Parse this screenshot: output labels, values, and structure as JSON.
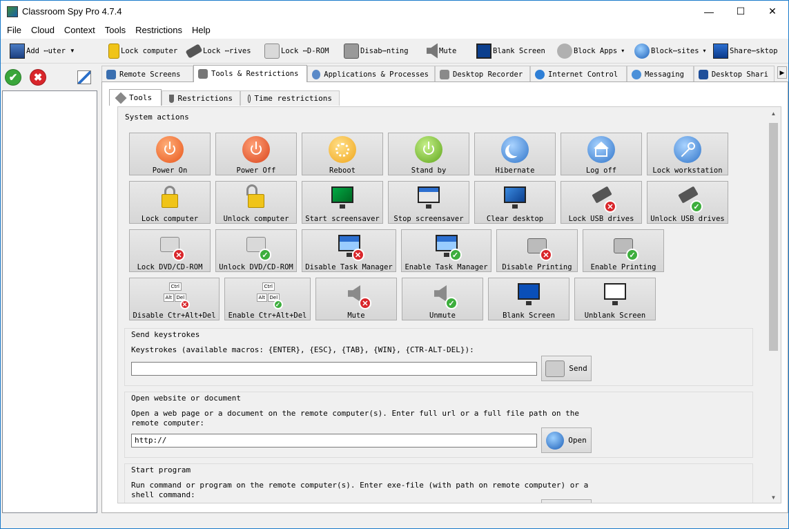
{
  "window": {
    "title": "Classroom Spy Pro 4.7.4",
    "minimize": "—",
    "maximize": "☐",
    "close": "✕"
  },
  "menu": [
    "File",
    "Cloud",
    "Context",
    "Tools",
    "Restrictions",
    "Help"
  ],
  "toolbar": [
    {
      "label": "Add ⋯uter",
      "icon": "add-computer-icon",
      "caret": "▼"
    },
    {
      "label": "Lock computer",
      "icon": "lock-icon"
    },
    {
      "label": "Lock ⋯rives",
      "icon": "lock-drives-icon"
    },
    {
      "label": "Lock ⋯D-ROM",
      "icon": "lock-cdrom-icon"
    },
    {
      "label": "Disab⋯nting",
      "icon": "disable-printing-icon"
    },
    {
      "label": "Mute",
      "icon": "mute-icon"
    },
    {
      "label": "Blank Screen",
      "icon": "blank-screen-icon"
    },
    {
      "label": "Block Apps",
      "icon": "block-apps-icon",
      "caret": "▾"
    },
    {
      "label": "Block⋯sites",
      "icon": "block-websites-icon",
      "caret": "▾"
    },
    {
      "label": "Share⋯sktop",
      "icon": "share-desktop-icon"
    }
  ],
  "left_tools": {
    "ok": "✔",
    "cancel": "✖"
  },
  "main_tabs": [
    {
      "label": "Remote Screens",
      "color": "#3a6fb0"
    },
    {
      "label": "Tools & Restrictions",
      "color": "#777777",
      "active": true
    },
    {
      "label": "Applications & Processes",
      "color": "#5a8ac8"
    },
    {
      "label": "Desktop Recorder",
      "color": "#8a8a8a"
    },
    {
      "label": "Internet Control",
      "color": "#2e7fd6"
    },
    {
      "label": "Messaging",
      "color": "#4a90d9"
    },
    {
      "label": "Desktop Shari",
      "color": "#1f4f9a"
    }
  ],
  "sub_tabs": [
    {
      "label": "Tools",
      "active": true
    },
    {
      "label": "Restrictions"
    },
    {
      "label": "Time restrictions"
    }
  ],
  "system_actions": {
    "title": "System actions",
    "row1": [
      "Power On",
      "Power Off",
      "Reboot",
      "Stand by",
      "Hibernate",
      "Log off",
      "Lock workstation"
    ],
    "row2": [
      "Lock computer",
      "Unlock computer",
      "Start screensaver",
      "Stop screensaver",
      "Clear desktop",
      "Lock USB drives",
      "Unlock USB drives"
    ],
    "row3": [
      "Lock DVD/CD-ROM",
      "Unlock DVD/CD-ROM",
      "Disable Task Manager",
      "Enable Task Manager",
      "Disable Printing",
      "Enable Printing"
    ],
    "row4": [
      "Disable Ctr+Alt+Del",
      "Enable Ctr+Alt+Del",
      "Mute",
      "Unmute",
      "Blank Screen",
      "Unblank Screen"
    ],
    "keys": {
      "ctrl": "Ctrl",
      "alt": "Alt",
      "del": "Del"
    }
  },
  "keystrokes": {
    "title": "Send keystrokes",
    "desc": "Keystrokes (available macros: {ENTER}, {ESC}, {TAB}, {WIN}, {CTR-ALT-DEL}):",
    "value": "",
    "button": "Send"
  },
  "website": {
    "title": "Open website or document",
    "desc": "Open a web page or a document on the remote computer(s). Enter full url or a full file path on the remote computer:",
    "value": "http://",
    "button": "Open"
  },
  "program": {
    "title": "Start program",
    "desc": "Run command or program on the remote computer(s). Enter exe-file (with path on remote computer) or a shell command:"
  }
}
